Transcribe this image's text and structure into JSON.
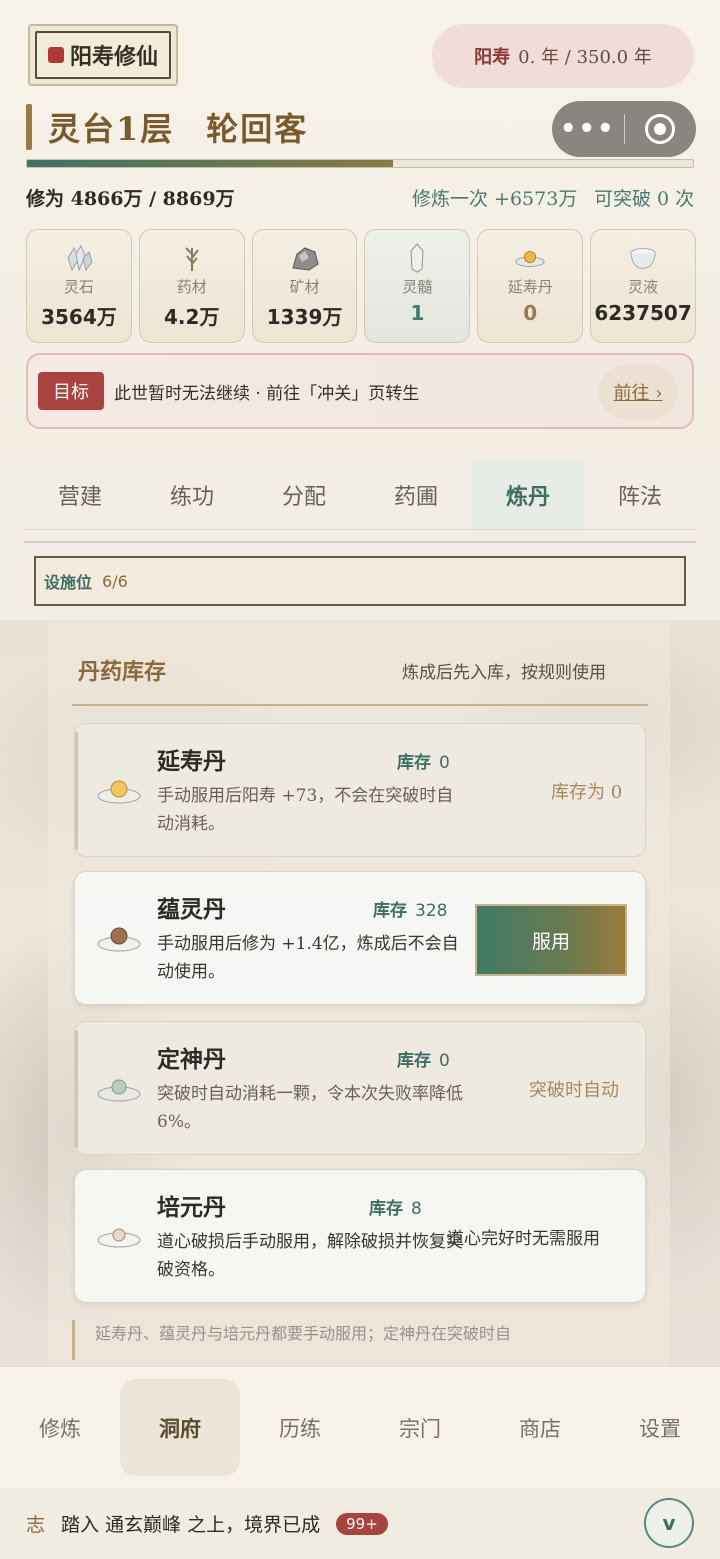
{
  "header": {
    "logo_text": "阳寿修仙",
    "lifespan_label": "阳寿",
    "lifespan_value": "0.  年 / 350.0 年",
    "realm": "灵台1层",
    "title": "轮回客",
    "capsule_dots": "•••"
  },
  "progress": {
    "fraction": 0.549
  },
  "cultivation": {
    "left": "修为 4866万 / 8869万",
    "per_run": "修炼一次 +6573万",
    "breakthrough": "可突破 0 次"
  },
  "resources": [
    {
      "icon": "crystal-icon",
      "label": "灵石",
      "value": "3564万"
    },
    {
      "icon": "herb-icon",
      "label": "药材",
      "value": "4.2万"
    },
    {
      "icon": "ore-icon",
      "label": "矿材",
      "value": "1339万"
    },
    {
      "icon": "marrow-icon",
      "label": "灵髓",
      "value": "1"
    },
    {
      "icon": "elixir-icon",
      "label": "延寿丹",
      "value": "0"
    },
    {
      "icon": "liquid-icon",
      "label": "灵液",
      "value": "6237507"
    }
  ],
  "goal": {
    "tag": "目标",
    "text": "此世暂时无法继续 · 前往「冲关」页转生",
    "button": "前往 ›"
  },
  "tabs": [
    "营建",
    "练功",
    "分配",
    "药圃",
    "炼丹",
    "阵法"
  ],
  "facility": {
    "label": "设施位",
    "value": "6/6"
  },
  "inventory": {
    "title": "丹药库存",
    "subtitle": "炼成后先入库，按规则使用",
    "stock_label": "库存",
    "pills": [
      {
        "name": "延寿丹",
        "stock": "0",
        "desc": "手动服用后阳寿 +73，不会在突破时自动消耗。",
        "status": "库存为 0"
      },
      {
        "name": "蕴灵丹",
        "stock": "328",
        "desc": "手动服用后修为 +1.4亿，炼成后不会自动使用。",
        "button": "服用"
      },
      {
        "name": "定神丹",
        "stock": "0",
        "desc": "突破时自动消耗一颗，令本次失败率降低 6%。",
        "status": "突破时自动"
      },
      {
        "name": "培元丹",
        "stock": "8",
        "desc": "道心破损后手动服用，解除破损并恢复突破资格。",
        "status": "道心完好时无需服用"
      }
    ],
    "tip": "延寿丹、蕴灵丹与培元丹都要手动服用；定神丹在突破时自"
  },
  "nav": [
    "修炼",
    "洞府",
    "历练",
    "宗门",
    "商店",
    "设置"
  ],
  "log": {
    "tag": "志",
    "text": "踏入 通玄巅峰 之上，境界已成",
    "badge": "99+",
    "toggle": "v"
  },
  "colors": {
    "accent": "#3e6e64",
    "gold": "#8a6a3a",
    "red": "#a8433d"
  }
}
